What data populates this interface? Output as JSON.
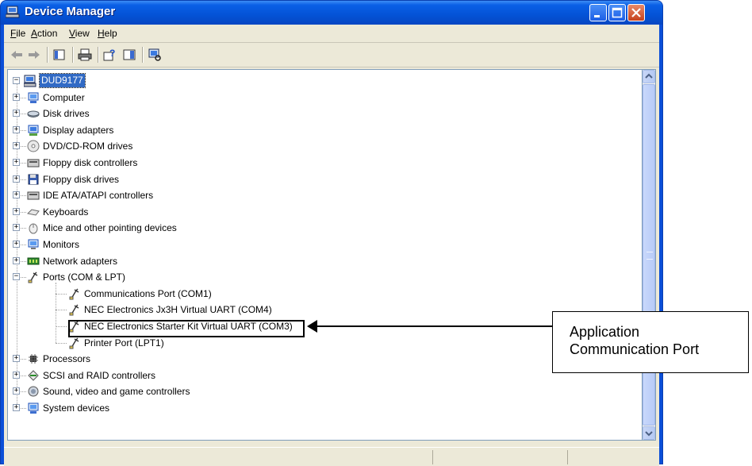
{
  "window": {
    "title": "Device Manager",
    "menu": [
      "File",
      "Action",
      "View",
      "Help"
    ]
  },
  "tree": {
    "root": "DUD9177",
    "categories": [
      {
        "label": "Computer",
        "icon": "computer-icon"
      },
      {
        "label": "Disk drives",
        "icon": "disk-drive-icon"
      },
      {
        "label": "Display adapters",
        "icon": "display-adapter-icon"
      },
      {
        "label": "DVD/CD-ROM drives",
        "icon": "cdrom-icon"
      },
      {
        "label": "Floppy disk controllers",
        "icon": "floppy-controller-icon"
      },
      {
        "label": "Floppy disk drives",
        "icon": "floppy-drive-icon"
      },
      {
        "label": "IDE ATA/ATAPI controllers",
        "icon": "ide-controller-icon"
      },
      {
        "label": "Keyboards",
        "icon": "keyboard-icon"
      },
      {
        "label": "Mice and other pointing devices",
        "icon": "mouse-icon"
      },
      {
        "label": "Monitors",
        "icon": "monitor-icon"
      },
      {
        "label": "Network adapters",
        "icon": "network-adapter-icon"
      },
      {
        "label": "Ports (COM & LPT)",
        "icon": "port-icon",
        "expanded": true
      },
      {
        "label": "Processors",
        "icon": "processor-icon"
      },
      {
        "label": "SCSI and RAID controllers",
        "icon": "scsi-icon"
      },
      {
        "label": "Sound, video and game controllers",
        "icon": "sound-icon"
      },
      {
        "label": "System devices",
        "icon": "system-device-icon"
      }
    ],
    "ports": [
      "Communications Port (COM1)",
      "NEC Electronics Jx3H Virtual UART (COM4)",
      "NEC Electronics Starter Kit Virtual UART (COM3)",
      "Printer Port (LPT1)"
    ]
  },
  "annotation": {
    "line1": "Application",
    "line2": "Communication Port"
  },
  "colors": {
    "titlebar": "#0a5fe6",
    "selection": "#316ac5",
    "chrome": "#ece9d8"
  }
}
